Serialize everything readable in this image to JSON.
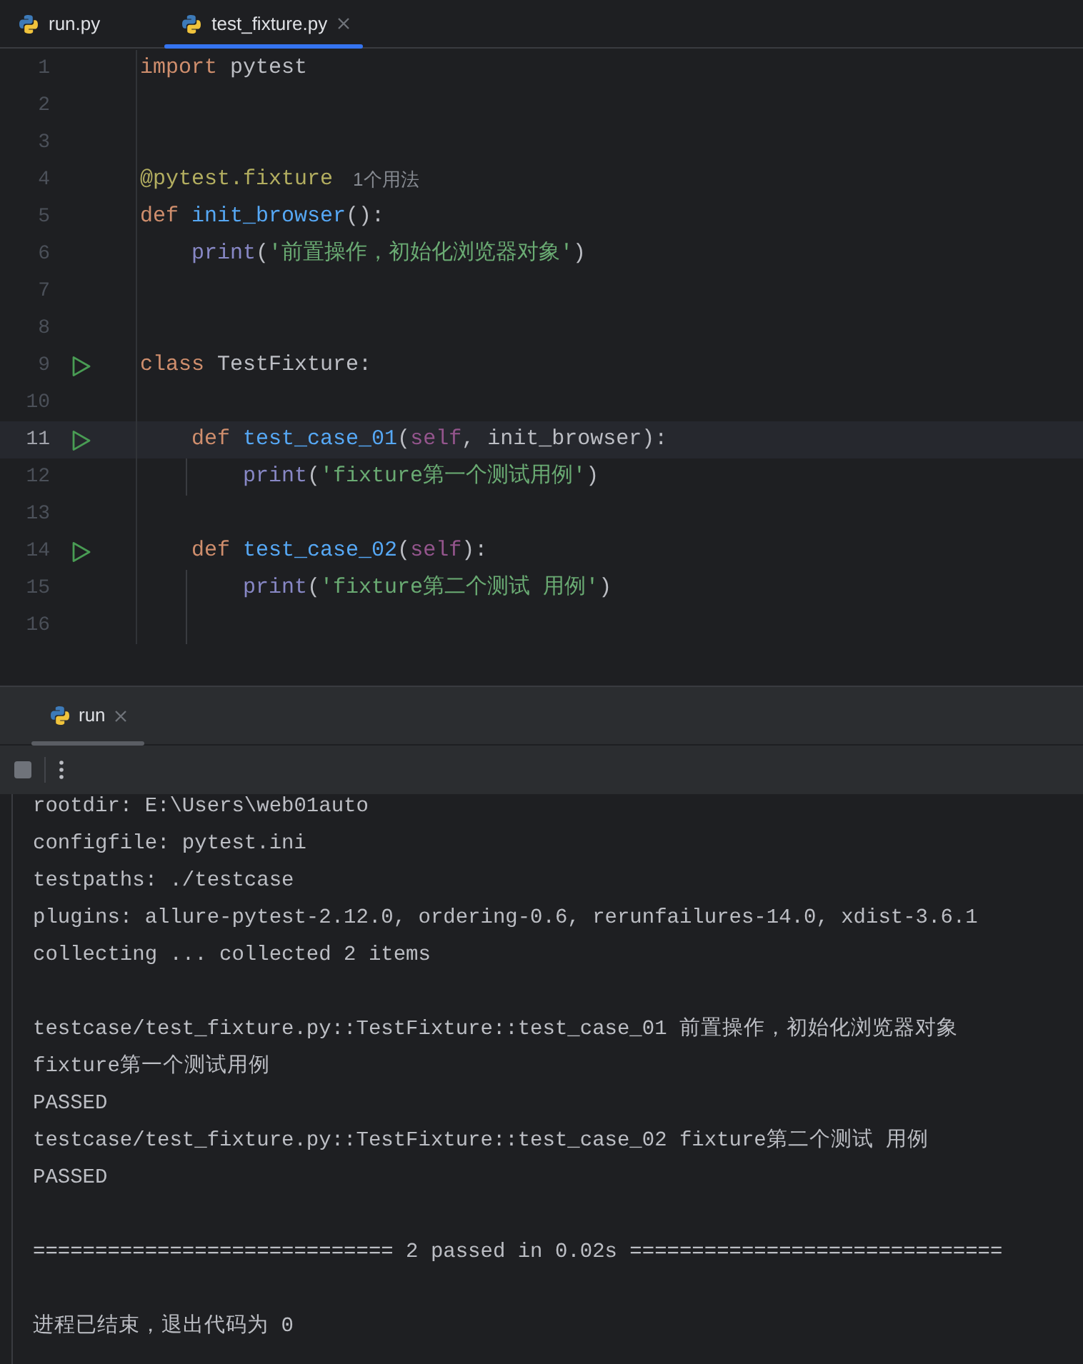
{
  "editor_tabs": [
    {
      "label": "run.py",
      "selected": false,
      "closable": false
    },
    {
      "label": "test_fixture.py",
      "selected": true,
      "closable": true
    }
  ],
  "editor": {
    "lines": [
      {
        "number": "1",
        "run_marker": false,
        "current": false,
        "indent_guide": false,
        "tokens": [
          {
            "kind": "keyword",
            "text": "import"
          },
          {
            "kind": "plain",
            "text": " pytest"
          }
        ]
      },
      {
        "number": "2",
        "run_marker": false,
        "current": false,
        "indent_guide": false
      },
      {
        "number": "3",
        "run_marker": false,
        "current": false,
        "indent_guide": false
      },
      {
        "number": "4",
        "run_marker": false,
        "current": false,
        "indent_guide": false,
        "tokens": [
          {
            "kind": "decorator",
            "text": "@pytest.fixture"
          },
          {
            "kind": "hint",
            "text": "1个用法"
          }
        ]
      },
      {
        "number": "5",
        "run_marker": false,
        "current": false,
        "indent_guide": false,
        "tokens": [
          {
            "kind": "keyword",
            "text": "def"
          },
          {
            "kind": "function",
            "text": " init_browser"
          },
          {
            "kind": "plain",
            "text": "():"
          }
        ]
      },
      {
        "number": "6",
        "run_marker": false,
        "current": false,
        "indent_guide": false,
        "tokens": [
          {
            "kind": "builtin",
            "text": "    print"
          },
          {
            "kind": "plain",
            "text": "("
          },
          {
            "kind": "string",
            "text": "'前置操作，初始化浏览器对象'"
          },
          {
            "kind": "plain",
            "text": ")"
          }
        ]
      },
      {
        "number": "7",
        "run_marker": false,
        "current": false,
        "indent_guide": false
      },
      {
        "number": "8",
        "run_marker": false,
        "current": false,
        "indent_guide": false
      },
      {
        "number": "9",
        "run_marker": true,
        "current": false,
        "indent_guide": false,
        "tokens": [
          {
            "kind": "keyword",
            "text": "class"
          },
          {
            "kind": "plain",
            "text": " TestFixture:"
          }
        ]
      },
      {
        "number": "10",
        "run_marker": false,
        "current": false,
        "indent_guide": false
      },
      {
        "number": "11",
        "run_marker": true,
        "current": true,
        "indent_guide": false,
        "tokens": [
          {
            "kind": "keyword",
            "text": "    def"
          },
          {
            "kind": "function",
            "text": " test_case_01"
          },
          {
            "kind": "plain",
            "text": "("
          },
          {
            "kind": "self",
            "text": "self"
          },
          {
            "kind": "plain",
            "text": ", init_browser):"
          }
        ]
      },
      {
        "number": "12",
        "run_marker": false,
        "current": false,
        "indent_guide": true,
        "tokens": [
          {
            "kind": "builtin",
            "text": "        print"
          },
          {
            "kind": "plain",
            "text": "("
          },
          {
            "kind": "string",
            "text": "'fixture第一个测试用例'"
          },
          {
            "kind": "plain",
            "text": ")"
          }
        ]
      },
      {
        "number": "13",
        "run_marker": false,
        "current": false,
        "indent_guide": false
      },
      {
        "number": "14",
        "run_marker": true,
        "current": false,
        "indent_guide": false,
        "tokens": [
          {
            "kind": "keyword",
            "text": "    def"
          },
          {
            "kind": "function",
            "text": " test_case_02"
          },
          {
            "kind": "plain",
            "text": "("
          },
          {
            "kind": "self",
            "text": "self"
          },
          {
            "kind": "plain",
            "text": "):"
          }
        ]
      },
      {
        "number": "15",
        "run_marker": false,
        "current": false,
        "indent_guide": true,
        "tokens": [
          {
            "kind": "builtin",
            "text": "        print"
          },
          {
            "kind": "plain",
            "text": "("
          },
          {
            "kind": "string",
            "text": "'fixture第二个测试 用例'"
          },
          {
            "kind": "plain",
            "text": ")"
          }
        ]
      },
      {
        "number": "16",
        "run_marker": false,
        "current": false,
        "indent_guide": true
      }
    ]
  },
  "run_panel": {
    "tabs": [
      {
        "label": "run",
        "selected": true,
        "closable": true
      }
    ],
    "console_blocks": [
      {
        "lines": [
          "rootdir: E:\\Users\\web01auto",
          "configfile: pytest.ini",
          "testpaths: ./testcase",
          "plugins: allure-pytest-2.12.0, ordering-0.6, rerunfailures-14.0, xdist-3.6.1",
          "collecting ... collected 2 items"
        ]
      },
      {
        "lines": [
          "testcase/test_fixture.py::TestFixture::test_case_01 前置操作，初始化浏览器对象",
          "fixture第一个测试用例",
          "PASSED",
          "testcase/test_fixture.py::TestFixture::test_case_02 fixture第二个测试 用例",
          "PASSED"
        ]
      },
      {
        "lines": [
          "============================= 2 passed in 0.02s =============================="
        ]
      },
      {
        "lines": [
          "进程已结束，退出代码为 0"
        ]
      }
    ]
  }
}
